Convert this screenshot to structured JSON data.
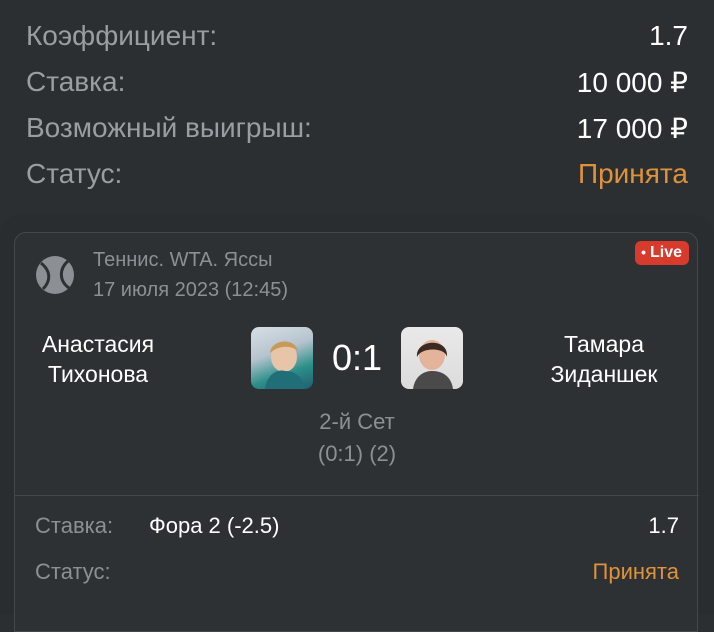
{
  "summary": {
    "coef_label": "Коэффициент:",
    "coef_value": "1.7",
    "stake_label": "Ставка:",
    "stake_value": "10 000 ₽",
    "win_label": "Возможный выигрыш:",
    "win_value": "17 000 ₽",
    "status_label": "Статус:",
    "status_value": "Принята"
  },
  "event": {
    "sport_icon": "tennis-ball-icon",
    "league": "Теннис. WTA. Яссы",
    "date": "17 июля 2023 (12:45)",
    "live_label": "Live",
    "player1": "Анастасия Тихонова",
    "player2": "Тамара Зиданшек",
    "score": "0:1",
    "set_info": "2-й Сет",
    "set_score": "(0:1) (2)"
  },
  "bet": {
    "label": "Ставка:",
    "market": "Фора 2 (-2.5)",
    "odds": "1.7",
    "status_label": "Статус:",
    "status_value": "Принята"
  },
  "colors": {
    "accent": "#e0923a",
    "live": "#d83a2b",
    "background": "#2c2f32"
  }
}
